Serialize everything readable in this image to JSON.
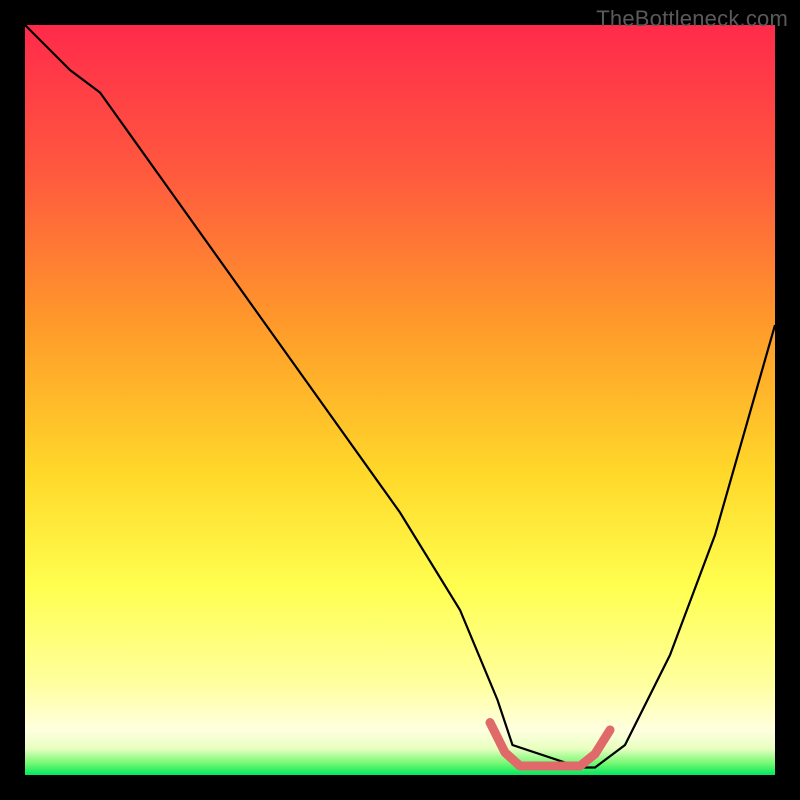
{
  "attribution": "TheBottleneck.com",
  "chart_data": {
    "type": "line",
    "title": "",
    "xlabel": "",
    "ylabel": "",
    "xlim": [
      0,
      100
    ],
    "ylim": [
      0,
      100
    ],
    "gradient_stops": [
      {
        "offset": 0.0,
        "color": "#ff2a4b"
      },
      {
        "offset": 0.2,
        "color": "#ff5a3e"
      },
      {
        "offset": 0.4,
        "color": "#ff9a2a"
      },
      {
        "offset": 0.6,
        "color": "#ffd92a"
      },
      {
        "offset": 0.75,
        "color": "#ffff50"
      },
      {
        "offset": 0.88,
        "color": "#ffffa0"
      },
      {
        "offset": 0.94,
        "color": "#ffffe0"
      },
      {
        "offset": 0.965,
        "color": "#e8ffc0"
      },
      {
        "offset": 0.985,
        "color": "#70f870"
      },
      {
        "offset": 1.0,
        "color": "#00e860"
      }
    ],
    "series": [
      {
        "name": "bottleneck-curve",
        "color": "#000000",
        "x": [
          0,
          3,
          6,
          10,
          20,
          30,
          40,
          50,
          58,
          63,
          65,
          74,
          76,
          80,
          86,
          92,
          100
        ],
        "values": [
          100,
          97,
          94,
          91,
          77,
          63,
          49,
          35,
          22,
          10,
          4,
          1,
          1,
          4,
          16,
          32,
          60
        ]
      },
      {
        "name": "optimal-region",
        "color": "#e06a6a",
        "x": [
          62,
          64,
          66,
          74,
          76,
          78
        ],
        "values": [
          7,
          3,
          1.2,
          1.2,
          2.8,
          6
        ]
      }
    ]
  }
}
